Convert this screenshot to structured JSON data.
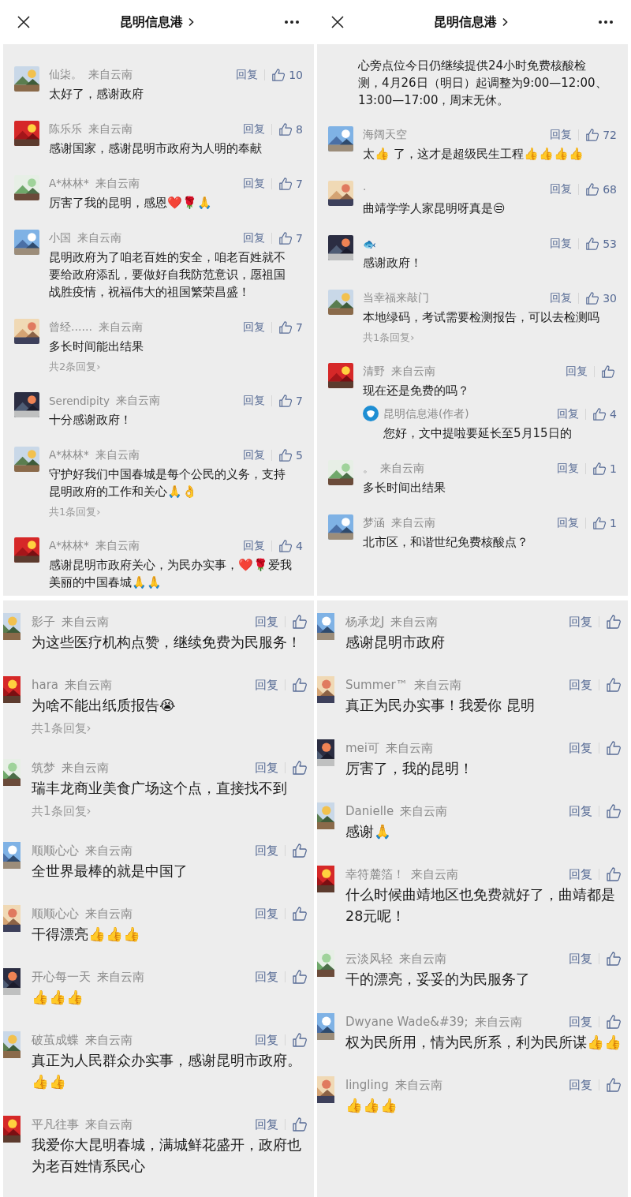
{
  "panels": [
    {
      "header": {
        "title": "昆明信息港"
      },
      "comments": [
        {
          "name": "仙柒。",
          "location": "来自云南",
          "reply": "回复",
          "likes": "10",
          "text": "太好了，感谢政府"
        },
        {
          "name": "陈乐乐",
          "location": "来自云南",
          "reply": "回复",
          "likes": "8",
          "text": "感谢国家，感谢昆明市政府为人明的奉献"
        },
        {
          "name": "A*林林*",
          "location": "来自云南",
          "reply": "回复",
          "likes": "7",
          "text": "厉害了我的昆明，感恩❤️🌹🙏"
        },
        {
          "name": "小国",
          "location": "来自云南",
          "reply": "回复",
          "likes": "7",
          "text": "昆明政府为了咱老百姓的安全，咱老百姓就不要给政府添乱，要做好自我防范意识，愿祖国战胜疫情，祝福伟大的祖国繁荣昌盛！"
        },
        {
          "name": "曾经……",
          "location": "来自云南",
          "reply": "回复",
          "likes": "7",
          "text": "多长时间能出结果",
          "more": "共2条回复›"
        },
        {
          "name": "Serendipity",
          "location": "来自云南",
          "reply": "回复",
          "likes": "7",
          "text": "十分感谢政府！"
        },
        {
          "name": "A*林林*",
          "location": "来自云南",
          "reply": "回复",
          "likes": "5",
          "text": "守护好我们中国春城是每个公民的义务，支持昆明政府的工作和关心🙏👌",
          "more": "共1条回复›"
        },
        {
          "name": "A*林林*",
          "location": "来自云南",
          "reply": "回复",
          "likes": "4",
          "text": "感谢昆明市政府关心，为民办实事，❤️🌹爱我美丽的中国春城🙏🙏"
        }
      ]
    },
    {
      "header": {
        "title": "昆明信息港"
      },
      "fragment": "心旁点位今日仍继续提供24小时免费核酸检测，4月26日（明日）起调整为9:00—12:00、13:00—17:00，周末无休。",
      "comments": [
        {
          "name": "海阔天空",
          "reply": "回复",
          "likes": "72",
          "text": "太👍 了，这才是超级民生工程👍👍👍👍"
        },
        {
          "name": "·",
          "reply": "回复",
          "likes": "68",
          "text": "曲靖学学人家昆明呀真是😒"
        },
        {
          "name": "🐟",
          "reply": "回复",
          "likes": "53",
          "text": "感谢政府！"
        },
        {
          "name": "当幸福来敲门",
          "reply": "回复",
          "likes": "30",
          "text": "本地绿码，考试需要检测报告，可以去检测吗",
          "more": "共1条回复›"
        },
        {
          "name": "清野",
          "location": "来自云南",
          "reply": "回复",
          "text": "现在还是免费的吗？",
          "author_reply": {
            "name": "昆明信息港(作者)",
            "reply": "回复",
            "likes": "4",
            "text": "您好，文中提啦要延长至5月15日的"
          }
        },
        {
          "name": "。",
          "location": "来自云南",
          "reply": "回复",
          "likes": "1",
          "text": "多长时间出结果"
        },
        {
          "name": "梦涵",
          "location": "来自云南",
          "reply": "回复",
          "likes": "1",
          "text": "北市区，和谐世纪免费核酸点？"
        }
      ]
    },
    {
      "comments": [
        {
          "name": "影子",
          "location": "来自云南",
          "reply": "回复",
          "text": "为这些医疗机构点赞，继续免费为民服务！"
        },
        {
          "name": "hara",
          "location": "来自云南",
          "reply": "回复",
          "text": "为啥不能出纸质报告😭",
          "more": "共1条回复›"
        },
        {
          "name": "筑梦",
          "location": "来自云南",
          "reply": "回复",
          "text": "瑞丰龙商业美食广场这个点，直接找不到",
          "more": "共1条回复›"
        },
        {
          "name": "顺顺心心",
          "location": "来自云南",
          "reply": "回复",
          "text": "全世界最棒的就是中国了"
        },
        {
          "name": "顺顺心心",
          "location": "来自云南",
          "reply": "回复",
          "text": "干得漂亮👍👍👍"
        },
        {
          "name": "开心每一天",
          "location": "来自云南",
          "reply": "回复",
          "text": "👍👍👍"
        },
        {
          "name": "破茧成蝶",
          "location": "来自云南",
          "reply": "回复",
          "text": "真正为人民群众办实事，感谢昆明市政府。👍👍"
        },
        {
          "name": "平凡往事",
          "location": "来自云南",
          "reply": "回复",
          "text": "我爱你大昆明春城，满城鲜花盛开，政府也为老百姓情系民心"
        }
      ]
    },
    {
      "comments": [
        {
          "name": "杨承龙J",
          "location": "来自云南",
          "reply": "回复",
          "text": "感谢昆明市政府"
        },
        {
          "name": "Summer™",
          "location": "来自云南",
          "reply": "回复",
          "text": "真正为民办实事！我爱你 昆明"
        },
        {
          "name": "mei可",
          "location": "来自云南",
          "reply": "回复",
          "text": "厉害了，我的昆明！"
        },
        {
          "name": "Danielle",
          "location": "来自云南",
          "reply": "回复",
          "text": "感谢🙏"
        },
        {
          "name": "幸符麓箔！",
          "location": "来自云南",
          "reply": "回复",
          "text": "什么时候曲靖地区也免费就好了，曲靖都是28元呢！"
        },
        {
          "name": "云淡风轻",
          "location": "来自云南",
          "reply": "回复",
          "text": "干的漂亮，妥妥的为民服务了"
        },
        {
          "name": "Dwyane Wade&#39;",
          "location": "来自云南",
          "reply": "回复",
          "text": "权为民所用，情为民所系，利为民所谋👍👍"
        },
        {
          "name": "lingling",
          "location": "来自云南",
          "reply": "回复",
          "text": "👍👍👍"
        }
      ]
    }
  ]
}
